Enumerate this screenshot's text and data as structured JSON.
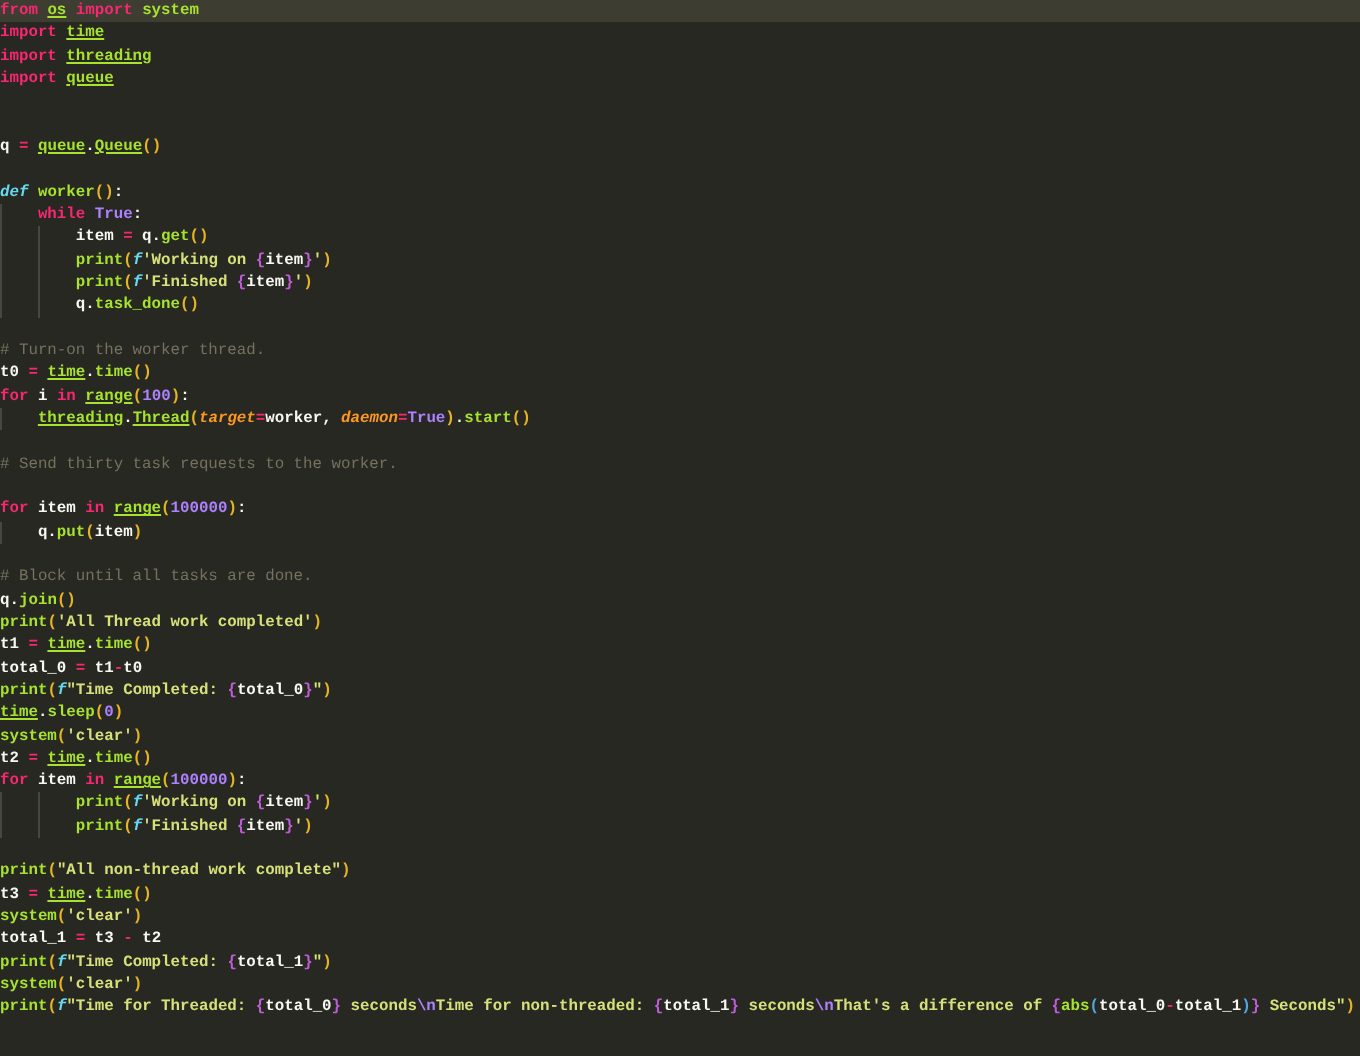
{
  "editor": {
    "lines": [
      {
        "selected": true,
        "tokens": [
          {
            "kind": "keyword",
            "text": "from "
          },
          {
            "kind": "module",
            "text": "os"
          },
          {
            "kind": "keyword",
            "text": " import "
          },
          {
            "kind": "function",
            "text": "system"
          }
        ]
      },
      {
        "selected": false,
        "tokens": [
          {
            "kind": "keyword",
            "text": "import "
          },
          {
            "kind": "module",
            "text": "time"
          }
        ]
      },
      {
        "selected": false,
        "tokens": [
          {
            "kind": "keyword",
            "text": "import "
          },
          {
            "kind": "module",
            "text": "threading"
          }
        ]
      },
      {
        "selected": false,
        "tokens": [
          {
            "kind": "keyword",
            "text": "import "
          },
          {
            "kind": "module",
            "text": "queue"
          }
        ]
      },
      {
        "selected": false
      },
      {
        "selected": false
      },
      {
        "selected": false,
        "tokens": [
          {
            "kind": "plain",
            "text": "q "
          },
          {
            "kind": "operator",
            "text": "= "
          },
          {
            "kind": "module",
            "text": "queue"
          },
          {
            "kind": "plain",
            "text": "."
          },
          {
            "kind": "module",
            "text": "Queue"
          },
          {
            "kind": "paren",
            "text": "()"
          }
        ]
      },
      {
        "selected": false
      },
      {
        "selected": false,
        "tokens": [
          {
            "kind": "storage",
            "text": "def "
          },
          {
            "kind": "function",
            "text": "worker"
          },
          {
            "kind": "paren",
            "text": "()"
          },
          {
            "kind": "plain",
            "text": ":"
          }
        ]
      },
      {
        "selected": false,
        "tokens": [
          {
            "kind": "keyword",
            "text": "    while "
          },
          {
            "kind": "constant",
            "text": "True"
          },
          {
            "kind": "plain",
            "text": ":"
          }
        ]
      },
      {
        "selected": false,
        "tokens": [
          {
            "kind": "plain",
            "text": "        item "
          },
          {
            "kind": "operator",
            "text": "="
          },
          {
            "kind": "plain",
            "text": " q."
          },
          {
            "kind": "function",
            "text": "get"
          },
          {
            "kind": "paren",
            "text": "()"
          }
        ]
      },
      {
        "selected": false,
        "tokens": [
          {
            "kind": "function",
            "text": "        print"
          },
          {
            "kind": "paren",
            "text": "("
          },
          {
            "kind": "prefix",
            "text": "f"
          },
          {
            "kind": "string",
            "text": "'Working on "
          },
          {
            "kind": "brace",
            "text": "{"
          },
          {
            "kind": "plain",
            "text": "item"
          },
          {
            "kind": "brace",
            "text": "}"
          },
          {
            "kind": "string",
            "text": "'"
          },
          {
            "kind": "paren",
            "text": ")"
          }
        ]
      },
      {
        "selected": false,
        "tokens": [
          {
            "kind": "function",
            "text": "        print"
          },
          {
            "kind": "paren",
            "text": "("
          },
          {
            "kind": "prefix",
            "text": "f"
          },
          {
            "kind": "string",
            "text": "'Finished "
          },
          {
            "kind": "brace",
            "text": "{"
          },
          {
            "kind": "plain",
            "text": "item"
          },
          {
            "kind": "brace",
            "text": "}"
          },
          {
            "kind": "string",
            "text": "'"
          },
          {
            "kind": "paren",
            "text": ")"
          }
        ]
      },
      {
        "selected": false,
        "tokens": [
          {
            "kind": "plain",
            "text": "        q."
          },
          {
            "kind": "function",
            "text": "task_done"
          },
          {
            "kind": "paren",
            "text": "()"
          }
        ]
      },
      {
        "selected": false
      },
      {
        "selected": false,
        "tokens": [
          {
            "kind": "comment",
            "text": "# Turn-on the worker thread."
          }
        ]
      },
      {
        "selected": false,
        "tokens": [
          {
            "kind": "plain",
            "text": "t0 "
          },
          {
            "kind": "operator",
            "text": "= "
          },
          {
            "kind": "module",
            "text": "time"
          },
          {
            "kind": "plain",
            "text": "."
          },
          {
            "kind": "function",
            "text": "time"
          },
          {
            "kind": "paren",
            "text": "()"
          }
        ]
      },
      {
        "selected": false,
        "tokens": [
          {
            "kind": "keyword",
            "text": "for"
          },
          {
            "kind": "plain",
            "text": " i "
          },
          {
            "kind": "keyword",
            "text": "in "
          },
          {
            "kind": "module",
            "text": "range"
          },
          {
            "kind": "paren",
            "text": "("
          },
          {
            "kind": "constant",
            "text": "100"
          },
          {
            "kind": "paren",
            "text": ")"
          },
          {
            "kind": "plain",
            "text": ":"
          }
        ]
      },
      {
        "selected": false,
        "tokens": [
          {
            "kind": "module",
            "text": "    threading"
          },
          {
            "kind": "plain",
            "text": "."
          },
          {
            "kind": "module",
            "text": "Thread"
          },
          {
            "kind": "paren",
            "text": "("
          },
          {
            "kind": "parameter",
            "text": "target"
          },
          {
            "kind": "operator",
            "text": "="
          },
          {
            "kind": "plain",
            "text": "worker, "
          },
          {
            "kind": "parameter",
            "text": "daemon"
          },
          {
            "kind": "operator",
            "text": "="
          },
          {
            "kind": "constant",
            "text": "True"
          },
          {
            "kind": "paren",
            "text": ")"
          },
          {
            "kind": "plain",
            "text": "."
          },
          {
            "kind": "function",
            "text": "start"
          },
          {
            "kind": "paren",
            "text": "()"
          }
        ]
      },
      {
        "selected": false
      },
      {
        "selected": false,
        "tokens": [
          {
            "kind": "comment",
            "text": "# Send thirty task requests to the worker."
          }
        ]
      },
      {
        "selected": false
      },
      {
        "selected": false,
        "tokens": [
          {
            "kind": "keyword",
            "text": "for"
          },
          {
            "kind": "plain",
            "text": " item "
          },
          {
            "kind": "keyword",
            "text": "in "
          },
          {
            "kind": "module",
            "text": "range"
          },
          {
            "kind": "paren",
            "text": "("
          },
          {
            "kind": "constant",
            "text": "100000"
          },
          {
            "kind": "paren",
            "text": ")"
          },
          {
            "kind": "plain",
            "text": ":"
          }
        ]
      },
      {
        "selected": false,
        "tokens": [
          {
            "kind": "plain",
            "text": "    q."
          },
          {
            "kind": "function",
            "text": "put"
          },
          {
            "kind": "paren",
            "text": "("
          },
          {
            "kind": "plain",
            "text": "item"
          },
          {
            "kind": "paren",
            "text": ")"
          }
        ]
      },
      {
        "selected": false
      },
      {
        "selected": false,
        "tokens": [
          {
            "kind": "comment",
            "text": "# Block until all tasks are done."
          }
        ]
      },
      {
        "selected": false,
        "tokens": [
          {
            "kind": "plain",
            "text": "q."
          },
          {
            "kind": "function",
            "text": "join"
          },
          {
            "kind": "paren",
            "text": "()"
          }
        ]
      },
      {
        "selected": false,
        "tokens": [
          {
            "kind": "function",
            "text": "print"
          },
          {
            "kind": "paren",
            "text": "("
          },
          {
            "kind": "string",
            "text": "'All Thread work completed'"
          },
          {
            "kind": "paren",
            "text": ")"
          }
        ]
      },
      {
        "selected": false,
        "tokens": [
          {
            "kind": "plain",
            "text": "t1 "
          },
          {
            "kind": "operator",
            "text": "= "
          },
          {
            "kind": "module",
            "text": "time"
          },
          {
            "kind": "plain",
            "text": "."
          },
          {
            "kind": "function",
            "text": "time"
          },
          {
            "kind": "paren",
            "text": "()"
          }
        ]
      },
      {
        "selected": false,
        "tokens": [
          {
            "kind": "plain",
            "text": "total_0 "
          },
          {
            "kind": "operator",
            "text": "="
          },
          {
            "kind": "plain",
            "text": " t1"
          },
          {
            "kind": "operator",
            "text": "-"
          },
          {
            "kind": "plain",
            "text": "t0"
          }
        ]
      },
      {
        "selected": false,
        "tokens": [
          {
            "kind": "function",
            "text": "print"
          },
          {
            "kind": "paren",
            "text": "("
          },
          {
            "kind": "prefix",
            "text": "f"
          },
          {
            "kind": "string",
            "text": "\"Time Completed: "
          },
          {
            "kind": "brace",
            "text": "{"
          },
          {
            "kind": "plain",
            "text": "total_0"
          },
          {
            "kind": "brace",
            "text": "}"
          },
          {
            "kind": "string",
            "text": "\""
          },
          {
            "kind": "paren",
            "text": ")"
          }
        ]
      },
      {
        "selected": false,
        "tokens": [
          {
            "kind": "module",
            "text": "time"
          },
          {
            "kind": "plain",
            "text": "."
          },
          {
            "kind": "function",
            "text": "sleep"
          },
          {
            "kind": "paren",
            "text": "("
          },
          {
            "kind": "constant",
            "text": "0"
          },
          {
            "kind": "paren",
            "text": ")"
          }
        ]
      },
      {
        "selected": false,
        "tokens": [
          {
            "kind": "function",
            "text": "system"
          },
          {
            "kind": "paren",
            "text": "("
          },
          {
            "kind": "string",
            "text": "'clear'"
          },
          {
            "kind": "paren",
            "text": ")"
          }
        ]
      },
      {
        "selected": false,
        "tokens": [
          {
            "kind": "plain",
            "text": "t2 "
          },
          {
            "kind": "operator",
            "text": "= "
          },
          {
            "kind": "module",
            "text": "time"
          },
          {
            "kind": "plain",
            "text": "."
          },
          {
            "kind": "function",
            "text": "time"
          },
          {
            "kind": "paren",
            "text": "()"
          }
        ]
      },
      {
        "selected": false,
        "tokens": [
          {
            "kind": "keyword",
            "text": "for"
          },
          {
            "kind": "plain",
            "text": " item "
          },
          {
            "kind": "keyword",
            "text": "in "
          },
          {
            "kind": "module",
            "text": "range"
          },
          {
            "kind": "paren",
            "text": "("
          },
          {
            "kind": "constant",
            "text": "100000"
          },
          {
            "kind": "paren",
            "text": ")"
          },
          {
            "kind": "plain",
            "text": ":"
          }
        ]
      },
      {
        "selected": false,
        "tokens": [
          {
            "kind": "function",
            "text": "        print"
          },
          {
            "kind": "paren",
            "text": "("
          },
          {
            "kind": "prefix",
            "text": "f"
          },
          {
            "kind": "string",
            "text": "'Working on "
          },
          {
            "kind": "brace",
            "text": "{"
          },
          {
            "kind": "plain",
            "text": "item"
          },
          {
            "kind": "brace",
            "text": "}"
          },
          {
            "kind": "string",
            "text": "'"
          },
          {
            "kind": "paren",
            "text": ")"
          }
        ]
      },
      {
        "selected": false,
        "tokens": [
          {
            "kind": "function",
            "text": "        print"
          },
          {
            "kind": "paren",
            "text": "("
          },
          {
            "kind": "prefix",
            "text": "f"
          },
          {
            "kind": "string",
            "text": "'Finished "
          },
          {
            "kind": "brace",
            "text": "{"
          },
          {
            "kind": "plain",
            "text": "item"
          },
          {
            "kind": "brace",
            "text": "}"
          },
          {
            "kind": "string",
            "text": "'"
          },
          {
            "kind": "paren",
            "text": ")"
          }
        ]
      },
      {
        "selected": false
      },
      {
        "selected": false,
        "tokens": [
          {
            "kind": "function",
            "text": "print"
          },
          {
            "kind": "paren",
            "text": "("
          },
          {
            "kind": "string",
            "text": "\"All non-thread work complete\""
          },
          {
            "kind": "paren",
            "text": ")"
          }
        ]
      },
      {
        "selected": false,
        "tokens": [
          {
            "kind": "plain",
            "text": "t3 "
          },
          {
            "kind": "operator",
            "text": "= "
          },
          {
            "kind": "module",
            "text": "time"
          },
          {
            "kind": "plain",
            "text": "."
          },
          {
            "kind": "function",
            "text": "time"
          },
          {
            "kind": "paren",
            "text": "()"
          }
        ]
      },
      {
        "selected": false,
        "tokens": [
          {
            "kind": "function",
            "text": "system"
          },
          {
            "kind": "paren",
            "text": "("
          },
          {
            "kind": "string",
            "text": "'clear'"
          },
          {
            "kind": "paren",
            "text": ")"
          }
        ]
      },
      {
        "selected": false,
        "tokens": [
          {
            "kind": "plain",
            "text": "total_1 "
          },
          {
            "kind": "operator",
            "text": "="
          },
          {
            "kind": "plain",
            "text": " t3 "
          },
          {
            "kind": "operator",
            "text": "-"
          },
          {
            "kind": "plain",
            "text": " t2"
          }
        ]
      },
      {
        "selected": false,
        "tokens": [
          {
            "kind": "function",
            "text": "print"
          },
          {
            "kind": "paren",
            "text": "("
          },
          {
            "kind": "prefix",
            "text": "f"
          },
          {
            "kind": "string",
            "text": "\"Time Completed: "
          },
          {
            "kind": "brace",
            "text": "{"
          },
          {
            "kind": "plain",
            "text": "total_1"
          },
          {
            "kind": "brace",
            "text": "}"
          },
          {
            "kind": "string",
            "text": "\""
          },
          {
            "kind": "paren",
            "text": ")"
          }
        ]
      },
      {
        "selected": false,
        "tokens": [
          {
            "kind": "function",
            "text": "system"
          },
          {
            "kind": "paren",
            "text": "("
          },
          {
            "kind": "string",
            "text": "'clear'"
          },
          {
            "kind": "paren",
            "text": ")"
          }
        ]
      },
      {
        "selected": false,
        "tokens": [
          {
            "kind": "function",
            "text": "print"
          },
          {
            "kind": "paren",
            "text": "("
          },
          {
            "kind": "prefix",
            "text": "f"
          },
          {
            "kind": "string",
            "text": "\"Time for Threaded: "
          },
          {
            "kind": "brace",
            "text": "{"
          },
          {
            "kind": "plain",
            "text": "total_0"
          },
          {
            "kind": "brace",
            "text": "}"
          },
          {
            "kind": "string",
            "text": " seconds"
          },
          {
            "kind": "escape",
            "text": "\\n"
          },
          {
            "kind": "string",
            "text": "Time for non-threaded: "
          },
          {
            "kind": "brace",
            "text": "{"
          },
          {
            "kind": "plain",
            "text": "total_1"
          },
          {
            "kind": "brace",
            "text": "}"
          },
          {
            "kind": "string",
            "text": " seconds"
          },
          {
            "kind": "escape",
            "text": "\\n"
          },
          {
            "kind": "string",
            "text": "That's a difference of "
          },
          {
            "kind": "brace",
            "text": "{"
          },
          {
            "kind": "function",
            "text": "abs"
          },
          {
            "kind": "innerparen",
            "text": "("
          },
          {
            "kind": "plain",
            "text": "total_0"
          },
          {
            "kind": "operator",
            "text": "-"
          },
          {
            "kind": "plain",
            "text": "total_1"
          },
          {
            "kind": "innerparen",
            "text": ")"
          },
          {
            "kind": "brace",
            "text": "}"
          },
          {
            "kind": "string",
            "text": " Seconds\""
          },
          {
            "kind": "paren",
            "text": ")"
          }
        ]
      }
    ]
  }
}
